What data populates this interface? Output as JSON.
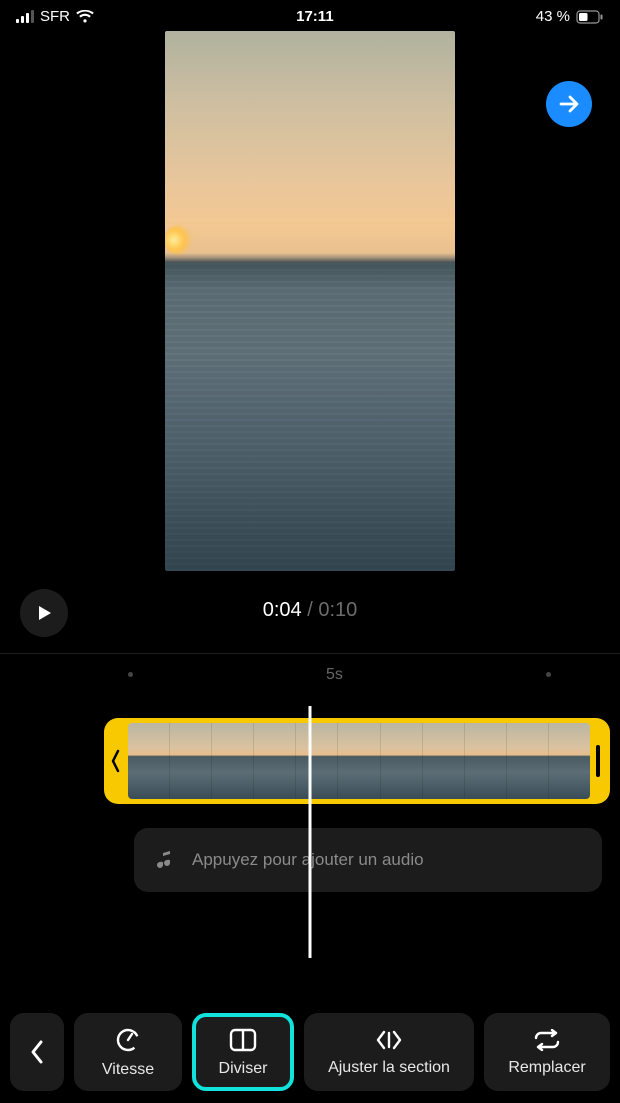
{
  "status": {
    "carrier": "SFR",
    "time": "17:11",
    "battery_pct": "43 %"
  },
  "playback": {
    "current": "0:04",
    "duration": "0:10"
  },
  "ruler": {
    "label_mid": "5s"
  },
  "audio": {
    "placeholder": "Appuyez pour ajouter un audio"
  },
  "tools": {
    "speed": "Vitesse",
    "split": "Diviser",
    "adjust": "Ajuster la section",
    "replace": "Remplacer"
  }
}
